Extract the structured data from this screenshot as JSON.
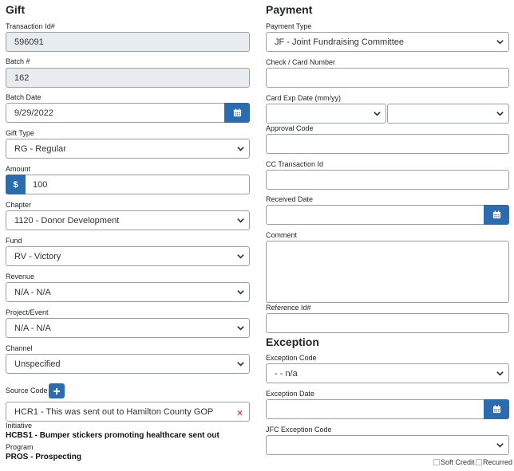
{
  "gift": {
    "heading": "Gift",
    "transaction_id": {
      "label": "Transaction Id#",
      "value": "596091"
    },
    "batch": {
      "label": "Batch #",
      "value": "162"
    },
    "batch_date": {
      "label": "Batch Date",
      "value": "9/29/2022"
    },
    "gift_type": {
      "label": "Gift Type",
      "value": "RG - Regular"
    },
    "amount": {
      "label": "Amount",
      "currency": "$",
      "value": "100"
    },
    "chapter": {
      "label": "Chapter",
      "value": "1120 - Donor Development"
    },
    "fund": {
      "label": "Fund",
      "value": "RV - Victory"
    },
    "revenue": {
      "label": "Revenue",
      "value": "N/A - N/A"
    },
    "project_event": {
      "label": "Project/Event",
      "value": "N/A - N/A"
    },
    "channel": {
      "label": "Channel",
      "value": "Unspecified"
    },
    "source_code": {
      "label": "Source Code",
      "value": "HCR1 - This was sent out to Hamilton County GOP",
      "clear_glyph": "×"
    },
    "initiative": {
      "label": "Initiative",
      "value": "HCBS1 - Bumper stickers promoting healthcare sent out"
    },
    "program": {
      "label": "Program",
      "value": "PROS - Prospecting"
    }
  },
  "payment": {
    "heading": "Payment",
    "payment_type": {
      "label": "Payment Type",
      "value": "JF - Joint Fundraising Committee"
    },
    "check_card_number": {
      "label": "Check / Card Number",
      "value": ""
    },
    "card_exp_date": {
      "label": "Card Exp Date (mm/yy)",
      "month": "",
      "year": ""
    },
    "approval_code": {
      "label": "Approval Code",
      "value": ""
    },
    "cc_transaction_id": {
      "label": "CC Transaction Id",
      "value": ""
    },
    "received_date": {
      "label": "Received Date",
      "value": ""
    },
    "comment": {
      "label": "Comment",
      "value": ""
    },
    "reference_id": {
      "label": "Reference Id#",
      "value": ""
    }
  },
  "exception": {
    "heading": "Exception",
    "exception_code": {
      "label": "Exception Code",
      "value": "- - n/a"
    },
    "exception_date": {
      "label": "Exception Date",
      "value": ""
    },
    "jfc_exception_code": {
      "label": "JFC Exception Code",
      "value": ""
    }
  },
  "flags": {
    "soft_credit": "Soft Credit",
    "recurred": "Recurred"
  },
  "icons": {
    "calendar": "calendar-icon",
    "chevron": "chevron-down-icon",
    "plus": "plus-icon",
    "clear": "close-icon"
  },
  "colors": {
    "accent": "#2b6cb0",
    "readonly_bg": "#e9ecef",
    "clear": "#e53935"
  }
}
